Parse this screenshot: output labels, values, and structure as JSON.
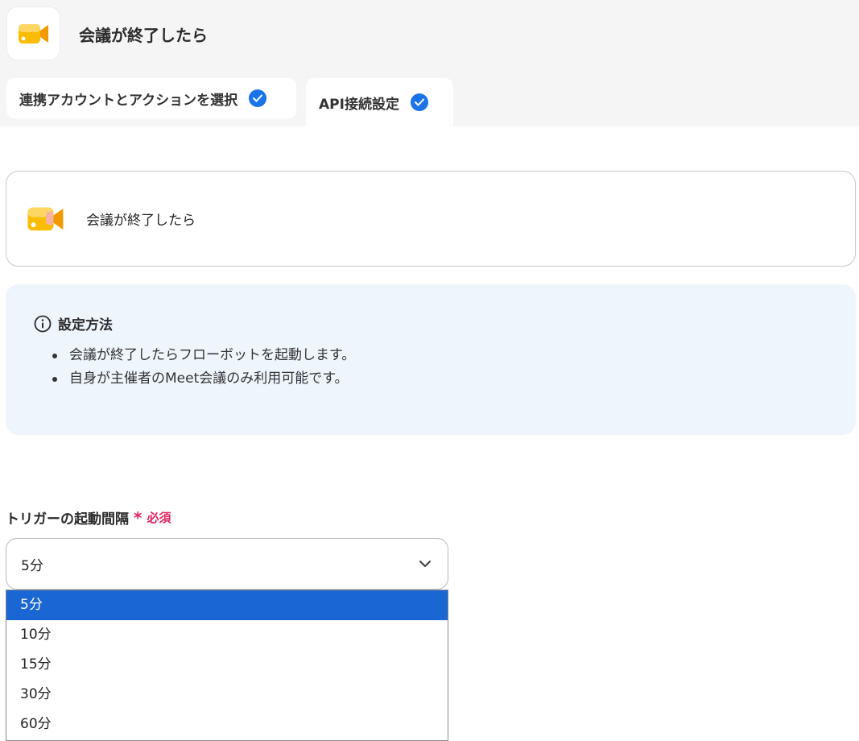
{
  "header": {
    "title": "会議が終了したら",
    "tabs": [
      {
        "label": "連携アカウントとアクションを選択"
      },
      {
        "label": "API接続設定"
      }
    ]
  },
  "trigger": {
    "label": "会議が終了したら"
  },
  "info": {
    "title": "設定方法",
    "items": [
      "会議が終了したらフローボットを起動します。",
      "自身が主催者のMeet会議のみ利用可能です。"
    ]
  },
  "field": {
    "label": "トリガーの起動間隔",
    "required_mark": "*",
    "required_label": "必須",
    "selected": "5分",
    "options": [
      "5分",
      "10分",
      "15分",
      "30分",
      "60分"
    ]
  },
  "colors": {
    "accent": "#1a73e8",
    "selected_option_bg": "#1a66d2",
    "required": "#e0245e",
    "info_bg": "#eef5fd",
    "meet_yellow": "#fbbc04",
    "meet_orange": "#f29900"
  },
  "icons": [
    "meet-camera-icon",
    "check-circle-icon",
    "info-icon",
    "chevron-down-icon"
  ]
}
